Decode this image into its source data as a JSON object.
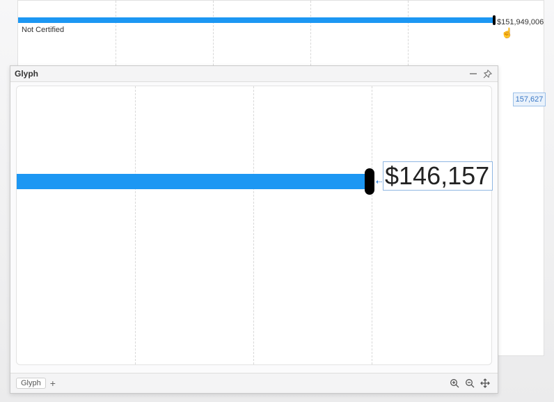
{
  "chart_data": {
    "type": "bar",
    "categories": [
      "Not Certified"
    ],
    "values": [
      151949006
    ],
    "value_labels": [
      "$151,949,006"
    ],
    "title": "",
    "xlabel": "",
    "ylabel": "",
    "ylim": [
      0,
      160000000
    ]
  },
  "background": {
    "category": "Not Certified",
    "end_label": "$151,949,006",
    "partial_label": "157,627"
  },
  "glyph": {
    "title": "Glyph",
    "tab_name": "Glyph",
    "preview_value": "$146,157"
  },
  "colors": {
    "bar": "#1c97f3",
    "tick": "#000000"
  }
}
